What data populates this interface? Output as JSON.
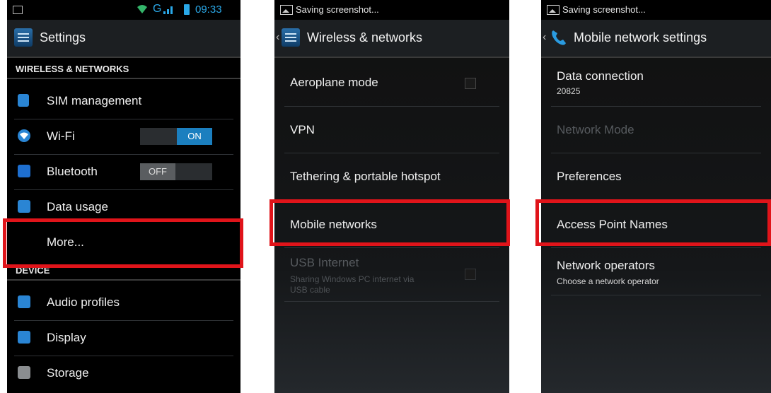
{
  "screen1": {
    "status": {
      "time": "09:33",
      "network": "G"
    },
    "title": "Settings",
    "sections": {
      "wireless": "WIRELESS & NETWORKS",
      "device": "DEVICE"
    },
    "items": {
      "sim": "SIM management",
      "wifi": "Wi-Fi",
      "wifi_toggle": "ON",
      "bluetooth": "Bluetooth",
      "bluetooth_toggle": "OFF",
      "data_usage": "Data usage",
      "more": "More...",
      "audio": "Audio profiles",
      "display": "Display",
      "storage": "Storage"
    }
  },
  "screen2": {
    "status": "Saving screenshot...",
    "title": "Wireless & networks",
    "items": {
      "aeroplane": "Aeroplane mode",
      "vpn": "VPN",
      "tethering": "Tethering & portable hotspot",
      "mobile": "Mobile networks",
      "usb": "USB Internet",
      "usb_sub_1": "Sharing Windows PC internet via",
      "usb_sub_2": "USB cable"
    }
  },
  "screen3": {
    "status": "Saving screenshot...",
    "title": "Mobile network settings",
    "items": {
      "data_conn": "Data connection",
      "data_conn_sub": "20825",
      "network_mode": "Network Mode",
      "preferences": "Preferences",
      "apn": "Access Point Names",
      "operators": "Network operators",
      "operators_sub": "Choose a network operator"
    }
  },
  "colors": {
    "highlight": "#e0141a",
    "accent": "#1b7fbf"
  }
}
